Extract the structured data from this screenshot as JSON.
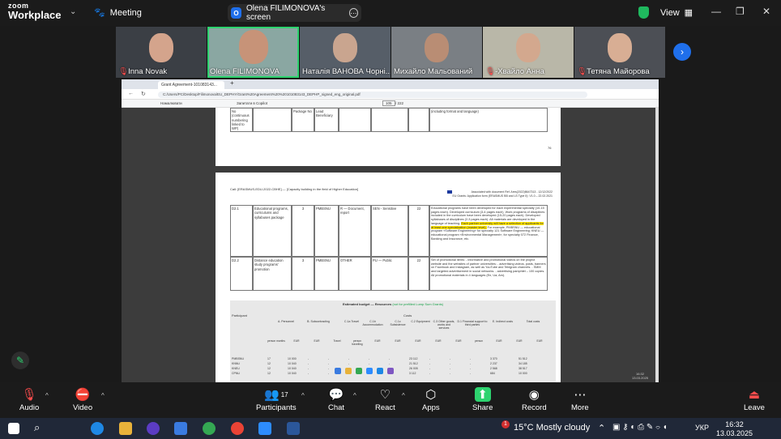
{
  "app": {
    "logo_line1": "zoom",
    "logo_line2": "Workplace",
    "meeting_label": "Meeting",
    "screen_share_label": "Olena FILIMONOVA's screen",
    "screen_share_initial": "O",
    "view_label": "View"
  },
  "participants": [
    {
      "name": "Inna Novak",
      "muted": true
    },
    {
      "name": "Olena FILIMONOVA",
      "muted": false,
      "active": true
    },
    {
      "name": "Наталія ВАНОВА Чорні...",
      "muted": false
    },
    {
      "name": "Михайло Мальований",
      "muted": false
    },
    {
      "name": "-Хвайло Анна",
      "muted": true
    },
    {
      "name": "Тетяна Майорова",
      "muted": true
    }
  ],
  "browser": {
    "tab_title": "Grant Agreement-101083143...",
    "url": "C:/Users/PC/Desktop/Filimonova/EU_DEPHY/Grant%20Agreement%20%20101083143_DEPHP_signed_eng_original.pdf",
    "pdf_page": "105",
    "pdf_total": "/ 222",
    "pdf_tool_label": "Намалювати",
    "pdf_ask_label": "Запитати в Copilot"
  },
  "pdf": {
    "page_number": "76",
    "header_left": "Call: [ERASMUS-EDU-2022-CBHE] — [Capacity building in the field of Higher Education]",
    "header_right1": "Associated with document Ref. Ares(2022)8647313 - 12/12/2022",
    "header_right2": "EU Grants: Application form (ERASMUS BB and LS Type II): V1.0 – 22.02.2021",
    "top_row": [
      "No (continuous numbering linked to WP)",
      "",
      "Package No",
      "Lead Beneficiary",
      "",
      "",
      "",
      "",
      "",
      "(including format and language)"
    ],
    "rows": [
      {
        "id": "D2.1",
        "name": "Educational programs, curriculums and syllabuses package",
        "wp": "3",
        "lead": "PMBSNU",
        "type": "R — Document, report",
        "diss": "SEN - Sensitive",
        "month": "22",
        "desc_a": "Educational programs have been developed for each experimental specialty (10-15 pages each). Developed curriculum (3-4 pages each). Work programs of disciplines included in the curriculum have been developed (15-20 pages each). Developed syllabuses of disciplines (2-3 pages each). All materials are developed in the language of teaching.",
        "desc_hl": "Each partner university will have a selection of applicants for at least one specialization (master level).",
        "desc_b": "For example, PMBSNU — educational program «Software Engineering» for specialty 121 Software Engineering; KNEU — educational program «Environmental Management», for specialty 072 Finance, Banking and Insurance, etc."
      },
      {
        "id": "D2.2",
        "name": "Distance education study programs' promotion",
        "wp": "3",
        "lead": "PMBSNU",
        "type": "OTHER",
        "diss": "PU — Public",
        "month": "22",
        "desc_a": "Set of promotional items: - informative and promotional videos on the project website and the websites of partner universities; - advertising videos, posts, banners on Facebook and Instagram, as well as YouTube and Telegram channels. - SMM and targeted advertisement in social networks. - advertising pamphlet – 100 copies. All promotional materials in 4 languages (En, Ua, Am).",
        "desc_hl": "",
        "desc_b": ""
      }
    ],
    "budget_title": "Estimated budget — Resources",
    "budget_title_note": "(not for prefilled Lump Sum Grants)",
    "budget_costs": "Costs",
    "budget_cols": [
      "A. Personnel",
      "B. Subcontracting",
      "C.1a Travel",
      "C.1b Accommodation",
      "C.1c Subsistence",
      "C.2 Equipment",
      "C.3 Other goods, works and services",
      "D.1 Financial support to third parties",
      "E. Indirect costs",
      "Total costs"
    ],
    "budget_sub": [
      "person months",
      "EUR",
      "EUR",
      "Travel",
      "person travelling",
      "EUR",
      "EUR",
      "EUR",
      "EUR",
      "EUR",
      "person",
      "EUR",
      "EUR",
      "EUR"
    ],
    "budget_participant": "Participant",
    "budget_rows": [
      [
        "PMBSNU",
        "17",
        "10 000",
        "-",
        "-",
        "-",
        "-",
        "-",
        "23 112",
        "-",
        "-",
        "-",
        "3 370",
        "51 512"
      ],
      [
        "KNNU",
        "12",
        "10 040",
        "-",
        "-",
        "-",
        "-",
        "-",
        "21 512",
        "-",
        "-",
        "-",
        "2 237",
        "34 185"
      ],
      [
        "KNEU",
        "12",
        "10 040",
        "-",
        "-",
        "-",
        "-",
        "-",
        "26 005",
        "-",
        "-",
        "-",
        "2 568",
        "38 517"
      ],
      [
        "CPNU",
        "12",
        "10 040",
        "-",
        "-",
        "-",
        "-",
        "-",
        "3 112",
        "-",
        "-",
        "-",
        "684",
        "10 000"
      ]
    ]
  },
  "controls": {
    "audio": "Audio",
    "video": "Video",
    "participants": "Participants",
    "participants_count": "17",
    "chat": "Chat",
    "react": "React",
    "apps": "Apps",
    "share": "Share",
    "record": "Record",
    "more": "More",
    "leave": "Leave"
  },
  "taskbar": {
    "weather_temp": "15°C",
    "weather_text": "Mostly cloudy",
    "language": "УКР",
    "time": "16:32",
    "date": "13.03.2025",
    "notif_badge": "1"
  },
  "inner_clock": {
    "time": "16:32",
    "date": "13.03.2025"
  }
}
